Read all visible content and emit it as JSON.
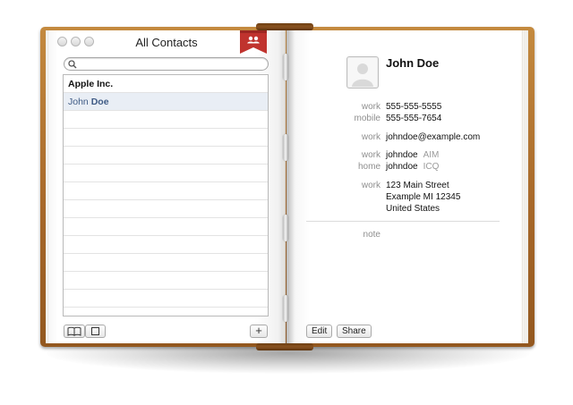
{
  "window": {
    "title": "All Contacts"
  },
  "search": {
    "placeholder": ""
  },
  "contacts": [
    {
      "first": "Apple Inc.",
      "last": "",
      "company": true
    },
    {
      "first": "John",
      "last": "Doe",
      "company": false,
      "selected": true
    }
  ],
  "card": {
    "name": "John Doe",
    "phones": [
      {
        "label": "work",
        "value": "555-555-5555"
      },
      {
        "label": "mobile",
        "value": "555-555-7654"
      }
    ],
    "email": {
      "label": "work",
      "value": "johndoe@example.com"
    },
    "im": [
      {
        "label": "work",
        "value": "johndoe",
        "service": "AIM"
      },
      {
        "label": "home",
        "value": "johndoe",
        "service": "ICQ"
      }
    ],
    "address": {
      "label": "work",
      "line1": "123 Main Street",
      "line2": "Example MI 12345",
      "line3": "United States"
    },
    "note_label": "note",
    "edit_label": "Edit",
    "share_label": "Share"
  },
  "toolbar": {
    "add_label": "+"
  },
  "colors": {
    "cover": "#a8692a",
    "ribbon": "#c0332e",
    "selection_text": "#3f5b85",
    "selection_bg": "#e9eef5"
  }
}
